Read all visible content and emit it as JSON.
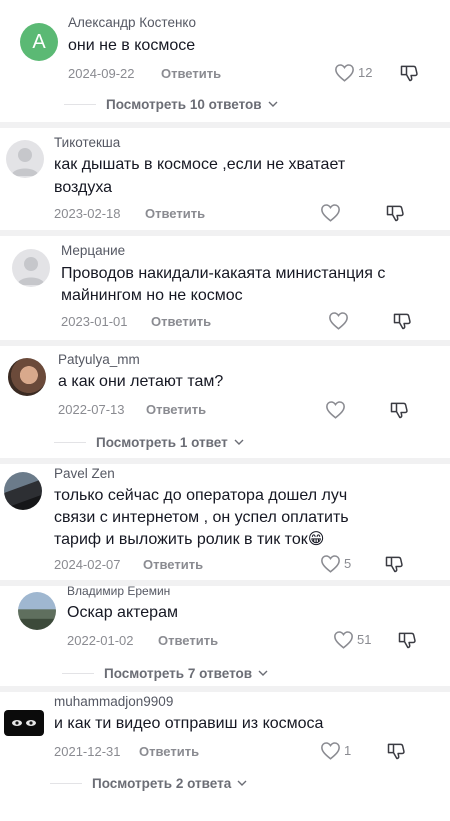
{
  "comments": [
    {
      "username": "Александр Костенко",
      "avatar_letter": "A",
      "text": "они не в космосе",
      "date": "2024-09-22",
      "reply_label": "Ответить",
      "likes": "12",
      "more_replies": "Посмотреть 10 ответов"
    },
    {
      "username": "Тикотекша",
      "text_line1": "как дышать в космосе ,если не хватает",
      "text_line2": "воздуха",
      "date": "2023-02-18",
      "reply_label": "Ответить"
    },
    {
      "username": "Мерцание",
      "text_line1": "Проводов накидали-какаята министанция с",
      "text_line2": "майнингом но не космос",
      "date": "2023-01-01",
      "reply_label": "Ответить"
    },
    {
      "username": "Patyulya_mm",
      "text": "а как они летают там?",
      "date": "2022-07-13",
      "reply_label": "Ответить",
      "more_replies": "Посмотреть 1 ответ"
    },
    {
      "username": "Pavel Zen",
      "text_line1": "только сейчас до оператора дошел луч",
      "text_line2": "связи с интернетом , он успел оплатить",
      "text_line3": "тариф и выложить ролик в тик ток😁",
      "date": "2024-02-07",
      "reply_label": "Ответить",
      "likes": "5"
    },
    {
      "username": "Владимир Еремин",
      "text": "Оскар актерам",
      "date": "2022-01-02",
      "reply_label": "Ответить",
      "likes": "51",
      "more_replies": "Посмотреть 7 ответов"
    },
    {
      "username": "muhammadjon9909",
      "text": "и как ти видео отправиш из космоса",
      "date": "2021-12-31",
      "reply_label": "Ответить",
      "likes": "1",
      "more_replies": "Посмотреть 2 ответа"
    }
  ],
  "icons": {
    "like": "heart-outline-icon",
    "dislike": "thumbs-down-icon",
    "expand": "chevron-down-icon"
  },
  "colors": {
    "text": "#161823",
    "muted": "#8a8b91",
    "letter_avatar": "#5bb974"
  }
}
